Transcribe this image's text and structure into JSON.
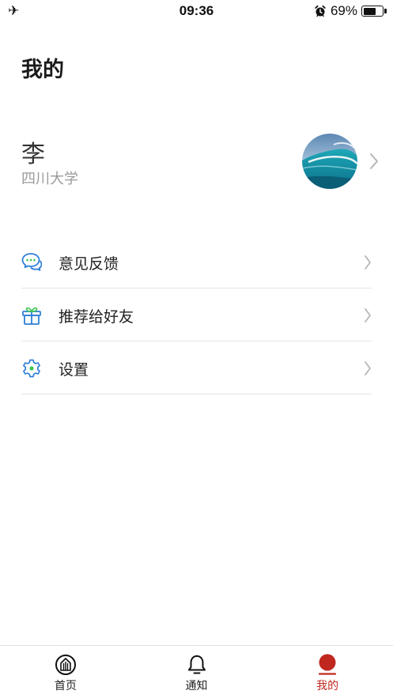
{
  "status_bar": {
    "airplane_icon": "✈",
    "time": "09:36",
    "battery_percent": "69%",
    "battery_level": 0.69,
    "icons": [
      "airplane-icon",
      "alarm-icon",
      "battery-icon"
    ]
  },
  "page": {
    "title": "我的"
  },
  "profile": {
    "name": "李",
    "school": "四川大学",
    "avatar_icon": "wave-avatar",
    "chevron_icon": "chevron-right-icon"
  },
  "menu": {
    "items": [
      {
        "label": "意见反馈",
        "icon": "chat-bubbles-icon"
      },
      {
        "label": "推荐给好友",
        "icon": "gift-icon"
      },
      {
        "label": "设置",
        "icon": "gear-icon"
      }
    ]
  },
  "tabbar": {
    "tabs": [
      {
        "label": "首页",
        "icon": "home-circle-icon",
        "active": false
      },
      {
        "label": "通知",
        "icon": "bell-icon",
        "active": false
      },
      {
        "label": "我的",
        "icon": "profile-dot-icon",
        "active": true
      }
    ]
  },
  "colors": {
    "accent_red": "#c0281f",
    "icon_blue": "#2f7fd8",
    "icon_green": "#3cc451",
    "divider": "#e6e6e6",
    "secondary_text": "#9a9a9a"
  }
}
